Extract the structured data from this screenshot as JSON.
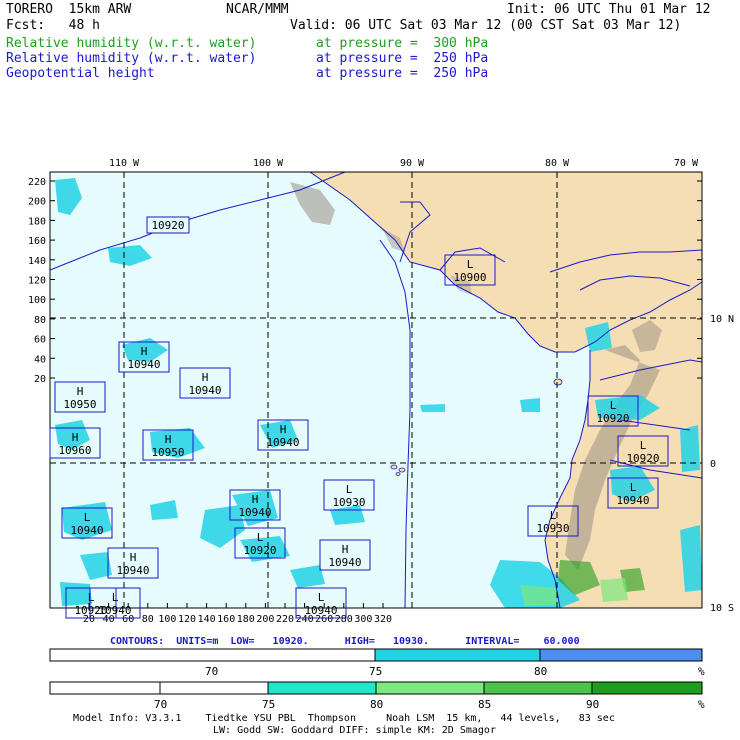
{
  "header": {
    "model": "TORERO  15km ARW",
    "center": "NCAR/MMM",
    "init": "Init: 06 UTC Thu 01 Mar 12",
    "fcst": "Fcst:   48 h",
    "valid": "Valid: 06 UTC Sat 03 Mar 12 (00 CST Sat 03 Mar 12)",
    "fields": [
      {
        "name": "Relative humidity (w.r.t. water)",
        "level": "at pressure =  300 hPa",
        "color": "#1e9e1e"
      },
      {
        "name": "Relative humidity (w.r.t. water)",
        "level": "at pressure =  250 hPa",
        "color": "#1a1acc"
      },
      {
        "name": "Geopotential height",
        "level": "at pressure =  250 hPa",
        "color": "#1a1acc"
      }
    ]
  },
  "map": {
    "lon_labels": [
      "110 W",
      "100 W",
      "90 W",
      "80 W",
      "70 W"
    ],
    "lat_labels": [
      "10 N",
      "0",
      "10 S"
    ],
    "y_ticks": [
      "220",
      "200",
      "180",
      "160",
      "140",
      "120",
      "100",
      "80",
      "60",
      "40",
      "20"
    ],
    "x_ticks": [
      "20",
      "40",
      "60",
      "80",
      "100",
      "120",
      "140",
      "160",
      "180",
      "200",
      "220",
      "240",
      "260",
      "280",
      "300",
      "320"
    ],
    "pressure_centers": [
      {
        "type": "L",
        "value": "10900"
      },
      {
        "type": "H",
        "value": "10940"
      },
      {
        "type": "H",
        "value": "10940"
      },
      {
        "type": "H",
        "value": "10950"
      },
      {
        "type": "H",
        "value": "10960"
      },
      {
        "type": "H",
        "value": "10950"
      },
      {
        "type": "H",
        "value": "10940"
      },
      {
        "type": "L",
        "value": "10920"
      },
      {
        "type": "L",
        "value": "10920"
      },
      {
        "type": "L",
        "value": "10930"
      },
      {
        "type": "L",
        "value": "10940"
      },
      {
        "type": "H",
        "value": "10940"
      },
      {
        "type": "L",
        "value": "10940"
      },
      {
        "type": "H",
        "value": "10940"
      },
      {
        "type": "L",
        "value": "10930"
      },
      {
        "type": "H",
        "value": "10940"
      },
      {
        "type": "L",
        "value": "10920"
      },
      {
        "type": "L",
        "value": "10920"
      },
      {
        "type": "L",
        "value": "10940"
      },
      {
        "type": "L",
        "value": "10940"
      }
    ],
    "contour_label": "10920"
  },
  "contours_info": "CONTOURS:  UNITS=m  LOW=   10920.      HIGH=   10930.      INTERVAL=    60.000",
  "colorbar1": {
    "labels": [
      "70",
      "75",
      "80"
    ],
    "unit": "%",
    "colors": [
      "#ffffff",
      "#22d3e6",
      "#4e8ef0"
    ]
  },
  "colorbar2": {
    "labels": [
      "70",
      "75",
      "80",
      "85",
      "90"
    ],
    "unit": "%",
    "colors": [
      "#ffffff",
      "#22e6c8",
      "#7de87d",
      "#4cc44c",
      "#1e9e1e"
    ]
  },
  "footer": {
    "line1": "Model Info: V3.3.1    Tiedtke YSU PBL  Thompson     Noah LSM  15 km,   44 levels,   83 sec",
    "line2": "LW: Godd SW: Goddard DIFF: simple KM: 2D Smagor"
  }
}
